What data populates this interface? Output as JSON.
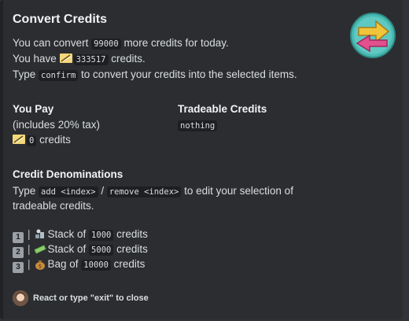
{
  "embed": {
    "title": "Convert Credits",
    "thumbnail_icon": "swap-arrows-icon",
    "desc_line1_prefix": "You can convert ",
    "desc_line1_code": "99000",
    "desc_line1_suffix": " more credits for today.",
    "desc_line2_prefix": "You have ",
    "desc_line2_code": "333517",
    "desc_line2_suffix": " credits.",
    "desc_line3_prefix": "Type ",
    "desc_line3_code": "confirm",
    "desc_line3_suffix": " to convert your credits into the selected items."
  },
  "you_pay": {
    "name": "You Pay",
    "line1": "(includes 20% tax)",
    "amount_code": "0",
    "amount_suffix": " credits"
  },
  "tradeable": {
    "name": "Tradeable Credits",
    "value_code": "nothing"
  },
  "denominations": {
    "name": "Credit Denominations",
    "line1_prefix": "Type ",
    "add_code": "add <index>",
    "slash": " / ",
    "remove_code": "remove <index>",
    "line1_suffix": " to edit your selection of",
    "line2": "tradeable credits.",
    "items": [
      {
        "index": "1",
        "sep": "|",
        "icon": "money-stack-icon",
        "label": "Stack of ",
        "amount": "1000",
        "unit": " credits"
      },
      {
        "index": "2",
        "sep": "|",
        "icon": "cash-bills-icon",
        "label": "Stack of ",
        "amount": "5000",
        "unit": " credits"
      },
      {
        "index": "3",
        "sep": "|",
        "icon": "money-bag-icon",
        "label": "Bag of ",
        "amount": "10000",
        "unit": " credits"
      }
    ]
  },
  "footer": {
    "text": "React or type \"exit\" to close",
    "avatar_icon": "user-avatar"
  },
  "colors": {
    "embed_bg": "#2b2d31",
    "page_bg": "#313338",
    "code_bg": "#1e1f22",
    "arrow_yellow": "#f0c53a",
    "arrow_pink": "#e2508f",
    "thumb_bg": "#48b9b2"
  }
}
